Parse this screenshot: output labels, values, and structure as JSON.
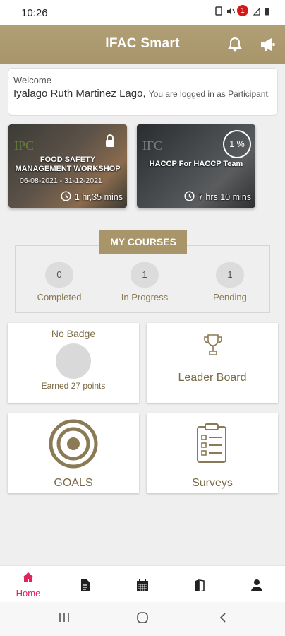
{
  "status": {
    "time": "10:26"
  },
  "appbar": {
    "title": "IFAC Smart",
    "notification_count": "1"
  },
  "welcome": {
    "greeting": "Welcome",
    "user_name": "Iyalago Ruth Martinez Lago,",
    "role_text": "You are logged in as Participant."
  },
  "courses": [
    {
      "logo": "IPC",
      "title": "FOOD SAFETY MANAGEMENT WORKSHOP",
      "dates": "06-08-2021 - 31-12-2021",
      "duration": "1 hr,35 mins",
      "locked": true
    },
    {
      "logo": "IFC",
      "title": "HACCP For HACCP Team",
      "progress": "1 %",
      "duration": "7 hrs,10 mins"
    }
  ],
  "my_courses": {
    "label": "MY COURSES",
    "stats": [
      {
        "value": "0",
        "label": "Completed"
      },
      {
        "value": "1",
        "label": "In Progress"
      },
      {
        "value": "1",
        "label": "Pending"
      }
    ]
  },
  "tiles": {
    "badge": {
      "title": "No Badge",
      "points": "Earned 27 points"
    },
    "leaderboard": {
      "label": "Leader Board"
    },
    "goals": {
      "label": "GOALS"
    },
    "surveys": {
      "label": "Surveys"
    }
  },
  "bottom_nav": {
    "home_label": "Home"
  },
  "colors": {
    "brand": "#a8956a",
    "accent": "#e0245e",
    "notification": "#d81818"
  },
  "icons": [
    "bell-icon",
    "megaphone-icon",
    "lock-icon",
    "clock-icon",
    "trophy-icon",
    "target-icon",
    "clipboard-icon",
    "home-icon",
    "document-icon",
    "calendar-icon",
    "books-icon",
    "person-icon"
  ]
}
